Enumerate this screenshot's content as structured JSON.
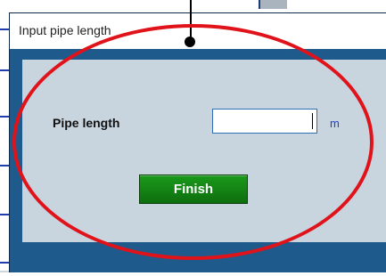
{
  "dialog": {
    "title": "Input pipe length",
    "pipe_length_label": "Pipe length",
    "pipe_length_value": "",
    "unit": "m",
    "finish_label": "Finish"
  },
  "colors": {
    "dialog_frame": "#1e5a8c",
    "content_bg": "#c8d4de",
    "finish_button": "#138013",
    "unit_text": "#1f3fd0",
    "annotation": "#e0131b"
  },
  "icons": {
    "annotation_marker": "pin-marker-icon"
  }
}
